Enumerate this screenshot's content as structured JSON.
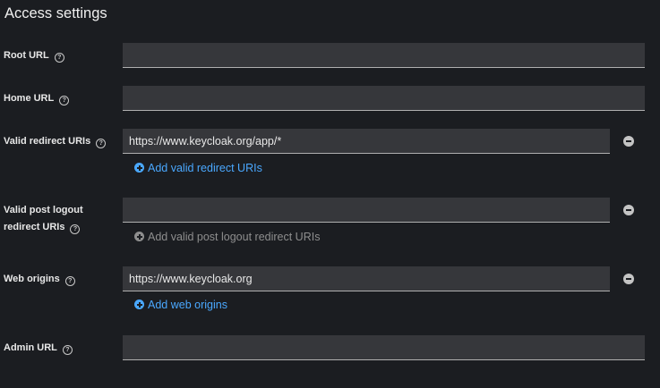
{
  "section": {
    "title": "Access settings"
  },
  "root_url": {
    "label": "Root URL",
    "value": ""
  },
  "home_url": {
    "label": "Home URL",
    "value": ""
  },
  "valid_redirect": {
    "label": "Valid redirect URIs",
    "value": "https://www.keycloak.org/app/*",
    "add_label": "Add valid redirect URIs"
  },
  "post_logout": {
    "label_line1": "Valid post logout",
    "label_line2": "redirect URIs",
    "value": "",
    "add_label": "Add valid post logout redirect URIs"
  },
  "web_origins": {
    "label": "Web origins",
    "value": "https://www.keycloak.org",
    "add_label": "Add web origins"
  },
  "admin_url": {
    "label": "Admin URL",
    "value": ""
  },
  "icons": {
    "help": "question-circle-icon",
    "remove": "minus-circle-icon",
    "add": "plus-circle-icon"
  },
  "colors": {
    "background": "#1b1d21",
    "input_bg": "#36373b",
    "link": "#4aa8ff",
    "disabled": "#8e8e8e"
  }
}
